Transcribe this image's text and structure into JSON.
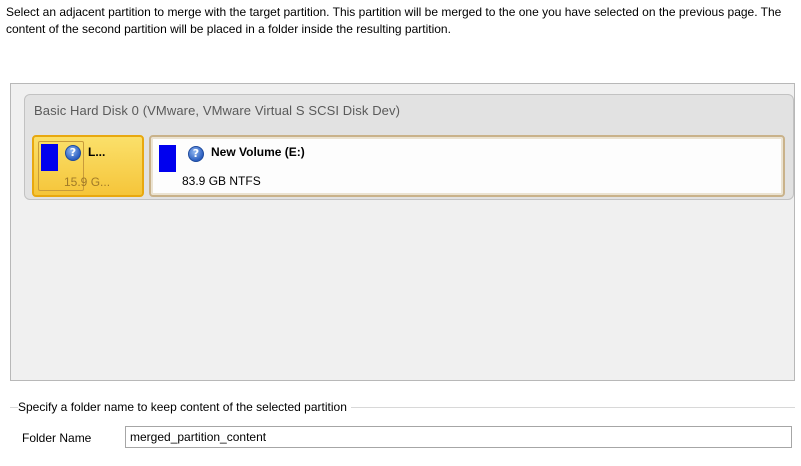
{
  "instructions": "Select an adjacent partition to merge with the target partition. This partition will be merged to the one you have selected on the previous page. The content of the second partition will be placed in a folder inside the resulting partition.",
  "disk": {
    "title": "Basic Hard Disk 0 (VMware, VMware Virtual S SCSI Disk Dev)",
    "partitions": [
      {
        "name": "L...",
        "size": "15.9 G...",
        "selected": true,
        "bar_color": "#0000ee",
        "icon": "help-icon"
      },
      {
        "name": "New Volume (E:)",
        "size": "83.9 GB NTFS",
        "selected": false,
        "bar_color": "#0000ee",
        "icon": "help-icon"
      }
    ]
  },
  "folder": {
    "legend": "Specify a folder name to keep content of the selected partition",
    "label": "Folder Name",
    "value": "merged_partition_content"
  },
  "colors": {
    "selected_fill": "#f5c53a",
    "selected_border": "#e8a810",
    "partition_bar": "#0000ee"
  }
}
